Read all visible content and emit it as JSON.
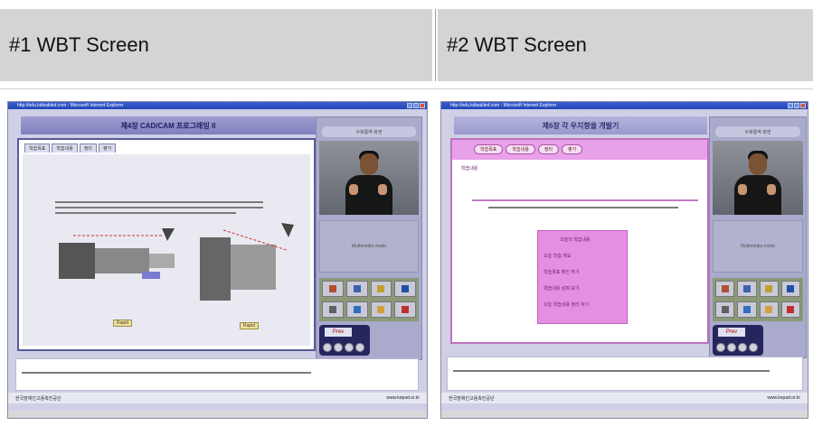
{
  "headers": {
    "left": "#1 WBT Screen",
    "right": "#2 WBT Screen"
  },
  "shot1": {
    "titlebar": "http://edu.kdisabled.com - Microsoft Internet Explorer",
    "title": "제4장 CAD/CAM 프로그래밍 II",
    "side_header": "수화통역 화면",
    "multimedia": "Multimedia mode",
    "tabs": [
      "학습목표",
      "학습내용",
      "정리",
      "평가"
    ],
    "label_a": "Rapid",
    "label_b": "Rapid",
    "nav_label": "Prev",
    "footer_left": "한국장애인고용촉진공단",
    "footer_right": "www.kepad.or.kr"
  },
  "shot2": {
    "titlebar": "http://edu.kdisabled.com - Microsoft Internet Explorer",
    "title": "제6장 각 우지향을 개발기",
    "side_header": "수화통역 화면",
    "multimedia": "Multimedia mode",
    "tabs": [
      "학습목표",
      "학습내용",
      "정리",
      "평가"
    ],
    "section": "학습내용",
    "box_title": "오늘의 학습내용",
    "box_items": [
      "오늘 학습 개요",
      "학습목표 확인 하기",
      "학습내용 살펴 보기",
      "오늘 학습내용 정리 하기"
    ],
    "nav_label": "Prev",
    "footer_left": "한국장애인고용촉진공단",
    "footer_right": "www.kepad.or.kr"
  }
}
